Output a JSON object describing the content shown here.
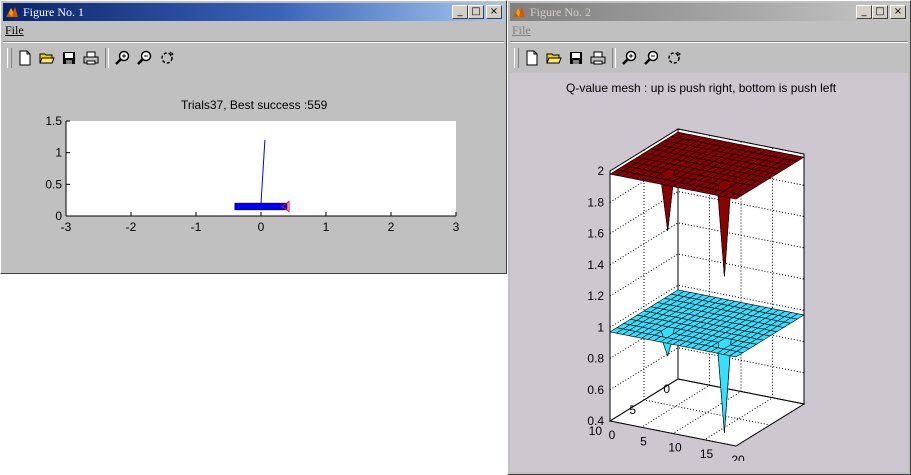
{
  "windows": [
    {
      "title": "Figure No. 1",
      "menu": [
        "File"
      ],
      "controls": {
        "minimize": "_",
        "maximize": "□",
        "close": "×"
      },
      "figure_title": "Trials37, Best success :559"
    },
    {
      "title": "Figure No. 2",
      "menu": [
        "File"
      ],
      "controls": {
        "minimize": "_",
        "maximize": "□",
        "close": "×"
      },
      "figure_title": "Q-value mesh : up is push right, bottom is push left"
    }
  ],
  "toolbar_icons": [
    "new-file-icon",
    "open-folder-icon",
    "save-icon",
    "print-icon",
    "zoom-in-icon",
    "zoom-out-icon",
    "rotate-icon"
  ],
  "chart_data": [
    {
      "type": "line",
      "title": "Trials37, Best success :559",
      "xlim": [
        -3,
        3
      ],
      "ylim": [
        0,
        1.5
      ],
      "xticks": [
        "-3",
        "-2",
        "-1",
        "0",
        "1",
        "2",
        "3"
      ],
      "yticks": [
        "0",
        "0.5",
        "1",
        "1.5"
      ],
      "cart": {
        "x_from": -0.4,
        "x_to": 0.4,
        "y_from": 0.1,
        "y_to": 0.2,
        "color": "#0000ff"
      },
      "pole": {
        "x0": 0.0,
        "y0": 0.2,
        "x1": 0.06,
        "y1": 1.2,
        "color": "#0000ff"
      },
      "marker_color": "#ff0000"
    },
    {
      "type": "surface",
      "title": "Q-value mesh : up is push right, bottom is push left",
      "zticks": [
        "0.4",
        "0.6",
        "0.8",
        "1",
        "1.2",
        "1.4",
        "1.6",
        "1.8",
        "2"
      ],
      "xticks": [
        "0",
        "5",
        "10",
        "15",
        "20"
      ],
      "yticks": [
        "0",
        "5",
        "10"
      ],
      "zlim": [
        0.4,
        2
      ],
      "series": [
        {
          "name": "up",
          "level": 1.98,
          "color": "#8b0000"
        },
        {
          "name": "bottom",
          "level": 0.97,
          "color": "#33e0ff"
        }
      ]
    }
  ]
}
